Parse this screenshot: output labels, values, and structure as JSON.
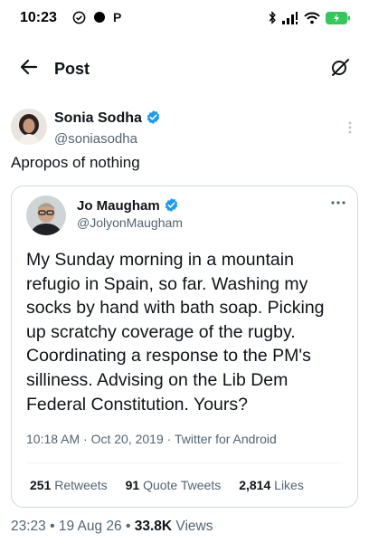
{
  "status_bar": {
    "time": "10:23",
    "left_indicators": [
      "check-circle",
      "dot",
      "P"
    ],
    "right_indicators": [
      "bluetooth",
      "signal",
      "wifi",
      "battery-charging"
    ],
    "letter_p": "P"
  },
  "header": {
    "title": "Post",
    "back_icon": "arrow-left-icon",
    "grok_icon": "grok-icon"
  },
  "post": {
    "author_name": "Sonia Sodha",
    "author_handle": "@soniasodha",
    "verified": true,
    "text": "Apropos of nothing",
    "footer": {
      "time": "23:23",
      "date": "19 Aug 26",
      "views_count": "33.8K",
      "views_label": "Views"
    }
  },
  "quoted": {
    "author_name": "Jo Maugham",
    "author_handle": "@JolyonMaugham",
    "verified": true,
    "text": "My Sunday morning in a mountain refugio in Spain, so far. Washing my socks by hand with bath soap. Picking up scratchy coverage of the rugby. Coordinating a response to the PM's silliness. Advising on the Lib Dem Federal Constitution. Yours?",
    "meta": "10:18 AM · Oct 20, 2019 · Twitter for Android",
    "stats": {
      "retweets_count": "251",
      "retweets_label": "Retweets",
      "quotes_count": "91",
      "quotes_label": "Quote Tweets",
      "likes_count": "2,814",
      "likes_label": "Likes"
    }
  },
  "colors": {
    "verified_blue": "#1d9bf0",
    "battery_green": "#34c759",
    "secondary_text": "#536471"
  }
}
